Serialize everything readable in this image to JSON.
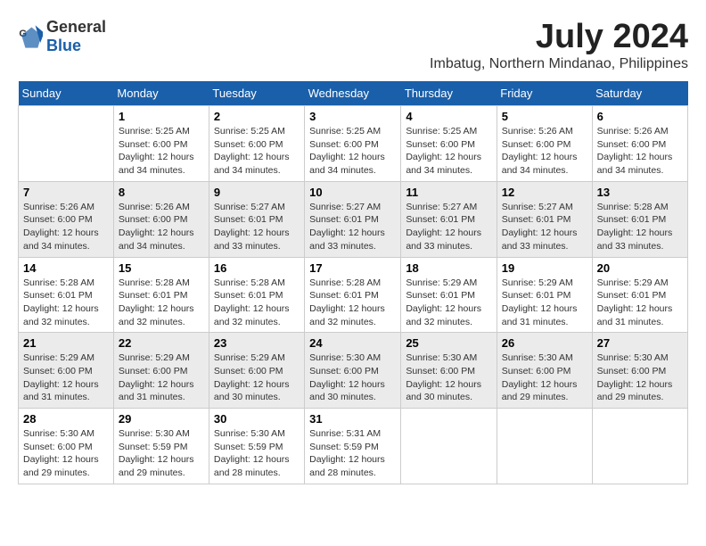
{
  "header": {
    "logo_general": "General",
    "logo_blue": "Blue",
    "month_year": "July 2024",
    "location": "Imbatug, Northern Mindanao, Philippines"
  },
  "calendar": {
    "days_of_week": [
      "Sunday",
      "Monday",
      "Tuesday",
      "Wednesday",
      "Thursday",
      "Friday",
      "Saturday"
    ],
    "weeks": [
      [
        {
          "day": "",
          "info": ""
        },
        {
          "day": "1",
          "info": "Sunrise: 5:25 AM\nSunset: 6:00 PM\nDaylight: 12 hours\nand 34 minutes."
        },
        {
          "day": "2",
          "info": "Sunrise: 5:25 AM\nSunset: 6:00 PM\nDaylight: 12 hours\nand 34 minutes."
        },
        {
          "day": "3",
          "info": "Sunrise: 5:25 AM\nSunset: 6:00 PM\nDaylight: 12 hours\nand 34 minutes."
        },
        {
          "day": "4",
          "info": "Sunrise: 5:25 AM\nSunset: 6:00 PM\nDaylight: 12 hours\nand 34 minutes."
        },
        {
          "day": "5",
          "info": "Sunrise: 5:26 AM\nSunset: 6:00 PM\nDaylight: 12 hours\nand 34 minutes."
        },
        {
          "day": "6",
          "info": "Sunrise: 5:26 AM\nSunset: 6:00 PM\nDaylight: 12 hours\nand 34 minutes."
        }
      ],
      [
        {
          "day": "7",
          "info": "Sunrise: 5:26 AM\nSunset: 6:00 PM\nDaylight: 12 hours\nand 34 minutes."
        },
        {
          "day": "8",
          "info": "Sunrise: 5:26 AM\nSunset: 6:00 PM\nDaylight: 12 hours\nand 34 minutes."
        },
        {
          "day": "9",
          "info": "Sunrise: 5:27 AM\nSunset: 6:01 PM\nDaylight: 12 hours\nand 33 minutes."
        },
        {
          "day": "10",
          "info": "Sunrise: 5:27 AM\nSunset: 6:01 PM\nDaylight: 12 hours\nand 33 minutes."
        },
        {
          "day": "11",
          "info": "Sunrise: 5:27 AM\nSunset: 6:01 PM\nDaylight: 12 hours\nand 33 minutes."
        },
        {
          "day": "12",
          "info": "Sunrise: 5:27 AM\nSunset: 6:01 PM\nDaylight: 12 hours\nand 33 minutes."
        },
        {
          "day": "13",
          "info": "Sunrise: 5:28 AM\nSunset: 6:01 PM\nDaylight: 12 hours\nand 33 minutes."
        }
      ],
      [
        {
          "day": "14",
          "info": "Sunrise: 5:28 AM\nSunset: 6:01 PM\nDaylight: 12 hours\nand 32 minutes."
        },
        {
          "day": "15",
          "info": "Sunrise: 5:28 AM\nSunset: 6:01 PM\nDaylight: 12 hours\nand 32 minutes."
        },
        {
          "day": "16",
          "info": "Sunrise: 5:28 AM\nSunset: 6:01 PM\nDaylight: 12 hours\nand 32 minutes."
        },
        {
          "day": "17",
          "info": "Sunrise: 5:28 AM\nSunset: 6:01 PM\nDaylight: 12 hours\nand 32 minutes."
        },
        {
          "day": "18",
          "info": "Sunrise: 5:29 AM\nSunset: 6:01 PM\nDaylight: 12 hours\nand 32 minutes."
        },
        {
          "day": "19",
          "info": "Sunrise: 5:29 AM\nSunset: 6:01 PM\nDaylight: 12 hours\nand 31 minutes."
        },
        {
          "day": "20",
          "info": "Sunrise: 5:29 AM\nSunset: 6:01 PM\nDaylight: 12 hours\nand 31 minutes."
        }
      ],
      [
        {
          "day": "21",
          "info": "Sunrise: 5:29 AM\nSunset: 6:00 PM\nDaylight: 12 hours\nand 31 minutes."
        },
        {
          "day": "22",
          "info": "Sunrise: 5:29 AM\nSunset: 6:00 PM\nDaylight: 12 hours\nand 31 minutes."
        },
        {
          "day": "23",
          "info": "Sunrise: 5:29 AM\nSunset: 6:00 PM\nDaylight: 12 hours\nand 30 minutes."
        },
        {
          "day": "24",
          "info": "Sunrise: 5:30 AM\nSunset: 6:00 PM\nDaylight: 12 hours\nand 30 minutes."
        },
        {
          "day": "25",
          "info": "Sunrise: 5:30 AM\nSunset: 6:00 PM\nDaylight: 12 hours\nand 30 minutes."
        },
        {
          "day": "26",
          "info": "Sunrise: 5:30 AM\nSunset: 6:00 PM\nDaylight: 12 hours\nand 29 minutes."
        },
        {
          "day": "27",
          "info": "Sunrise: 5:30 AM\nSunset: 6:00 PM\nDaylight: 12 hours\nand 29 minutes."
        }
      ],
      [
        {
          "day": "28",
          "info": "Sunrise: 5:30 AM\nSunset: 6:00 PM\nDaylight: 12 hours\nand 29 minutes."
        },
        {
          "day": "29",
          "info": "Sunrise: 5:30 AM\nSunset: 5:59 PM\nDaylight: 12 hours\nand 29 minutes."
        },
        {
          "day": "30",
          "info": "Sunrise: 5:30 AM\nSunset: 5:59 PM\nDaylight: 12 hours\nand 28 minutes."
        },
        {
          "day": "31",
          "info": "Sunrise: 5:31 AM\nSunset: 5:59 PM\nDaylight: 12 hours\nand 28 minutes."
        },
        {
          "day": "",
          "info": ""
        },
        {
          "day": "",
          "info": ""
        },
        {
          "day": "",
          "info": ""
        }
      ]
    ]
  }
}
